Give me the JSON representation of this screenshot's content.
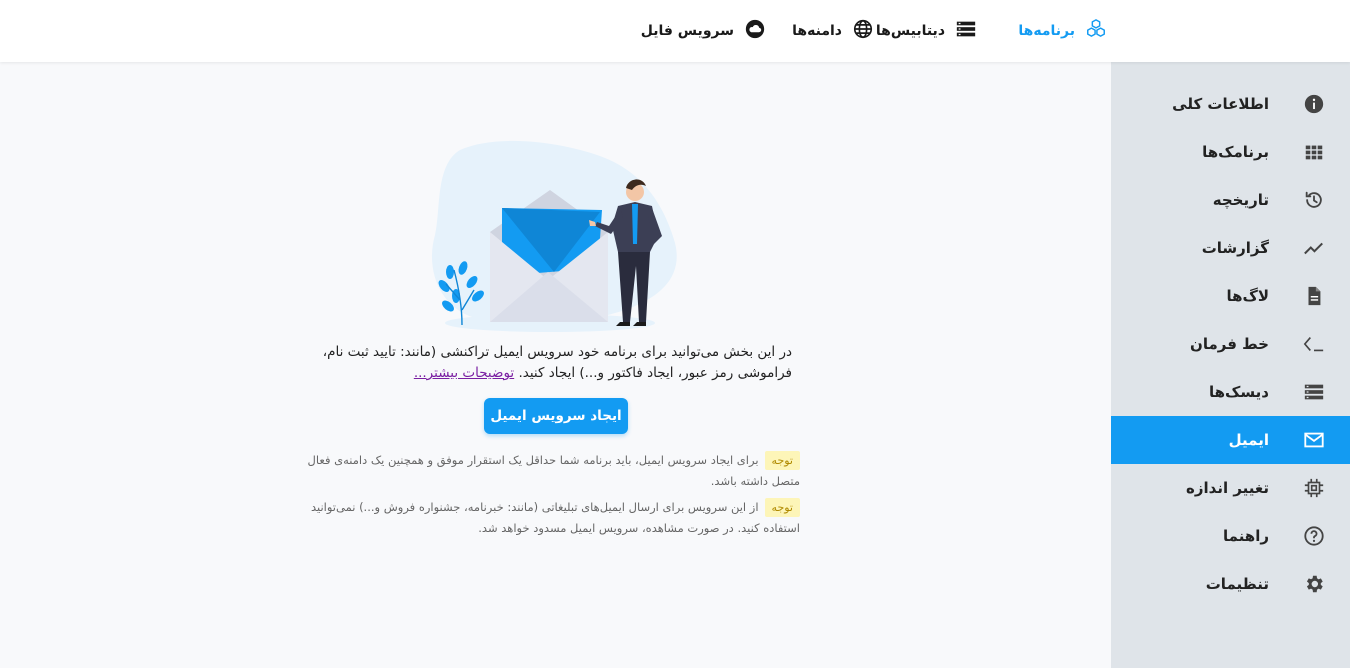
{
  "topnav": {
    "apps": {
      "label": "برنامه‌ها",
      "icon": "cubes-icon"
    },
    "databases": {
      "label": "دیتابیس‌ها",
      "icon": "database-icon"
    },
    "domains": {
      "label": "دامنه‌ها",
      "icon": "globe-icon"
    },
    "file_service": {
      "label": "سرویس فایل",
      "icon": "cloud-icon"
    }
  },
  "sidebar": {
    "items": [
      {
        "label": "اطلاعات کلی",
        "icon": "info-icon"
      },
      {
        "label": "برنامک‌ها",
        "icon": "grid-icon"
      },
      {
        "label": "تاریخچه",
        "icon": "history-icon"
      },
      {
        "label": "گزارشات",
        "icon": "trend-icon"
      },
      {
        "label": "لاگ‌ها",
        "icon": "document-icon"
      },
      {
        "label": "خط فرمان",
        "icon": "terminal-icon"
      },
      {
        "label": "دیسک‌ها",
        "icon": "disk-icon"
      },
      {
        "label": "ایمیل",
        "icon": "mail-icon",
        "active": true
      },
      {
        "label": "تغییر اندازه",
        "icon": "chip-icon"
      },
      {
        "label": "راهنما",
        "icon": "help-icon"
      },
      {
        "label": "تنظیمات",
        "icon": "gear-icon"
      }
    ]
  },
  "main": {
    "description": "در این بخش می‌توانید برای برنامه خود سرویس ایمیل تراکنشی (مانند: تایید ثبت نام، فراموشی رمز عبور، ایجاد فاکتور و...) ایجاد کنید.",
    "more_link": "توضیحات بیشتر...",
    "create_button": "ایجاد سرویس ایمیل",
    "notes": [
      {
        "badge": "توجه",
        "text": "برای ایجاد سرویس ایمیل، باید برنامه شما حداقل یک استقرار موفق و همچنین یک دامنه‌ی فعال متصل داشته باشد."
      },
      {
        "badge": "توجه",
        "text": "از این سرویس برای ارسال ایمیل‌های تبلیغاتی (مانند: خبرنامه، جشنواره فروش و...) نمی‌توانید استفاده کنید. در صورت مشاهده، سرویس ایمیل مسدود خواهد شد."
      }
    ]
  },
  "colors": {
    "accent": "#139bf2",
    "sidebar_bg": "#dfe4e9",
    "badge_bg": "#fdf5b8"
  }
}
